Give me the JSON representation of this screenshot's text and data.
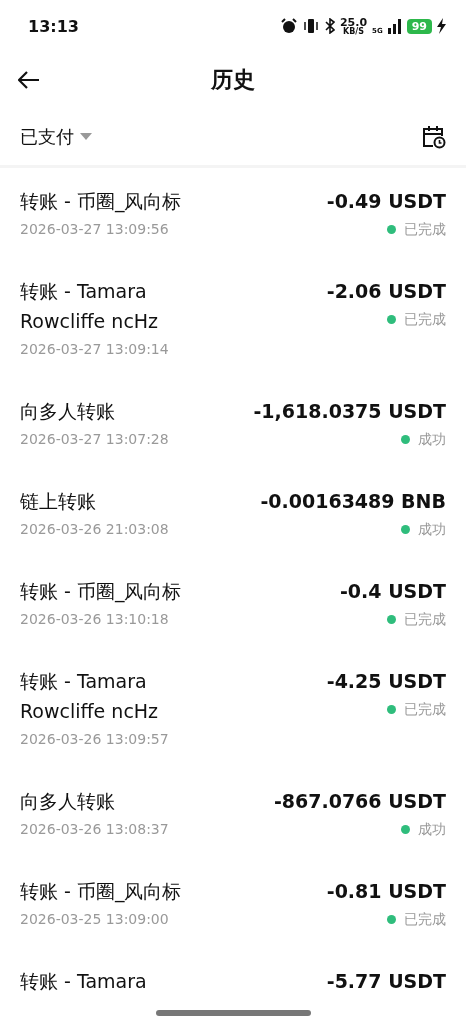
{
  "status_bar": {
    "time": "13:13",
    "speed": "25.0",
    "speed_unit": "KB/S",
    "network": "5G",
    "battery": "99"
  },
  "header": {
    "title": "历史"
  },
  "filter": {
    "label": "已支付"
  },
  "transactions": [
    {
      "title": "转账 - 币圈_风向标",
      "date": "2026-03-27 13:09:56",
      "amount": "-0.49 USDT",
      "status": "已完成"
    },
    {
      "title": "转账 - Tamara Rowcliffe ncHz",
      "date": "2026-03-27 13:09:14",
      "amount": "-2.06 USDT",
      "status": "已完成"
    },
    {
      "title": "向多人转账",
      "date": "2026-03-27 13:07:28",
      "amount": "-1,618.0375 USDT",
      "status": "成功"
    },
    {
      "title": "链上转账",
      "date": "2026-03-26 21:03:08",
      "amount": "-0.00163489 BNB",
      "status": "成功"
    },
    {
      "title": "转账 - 币圈_风向标",
      "date": "2026-03-26 13:10:18",
      "amount": "-0.4 USDT",
      "status": "已完成"
    },
    {
      "title": "转账 - Tamara Rowcliffe ncHz",
      "date": "2026-03-26 13:09:57",
      "amount": "-4.25 USDT",
      "status": "已完成"
    },
    {
      "title": "向多人转账",
      "date": "2026-03-26 13:08:37",
      "amount": "-867.0766 USDT",
      "status": "成功"
    },
    {
      "title": "转账 - 币圈_风向标",
      "date": "2026-03-25 13:09:00",
      "amount": "-0.81 USDT",
      "status": "已完成"
    },
    {
      "title": "转账 - Tamara",
      "amount": "-5.77 USDT"
    }
  ]
}
